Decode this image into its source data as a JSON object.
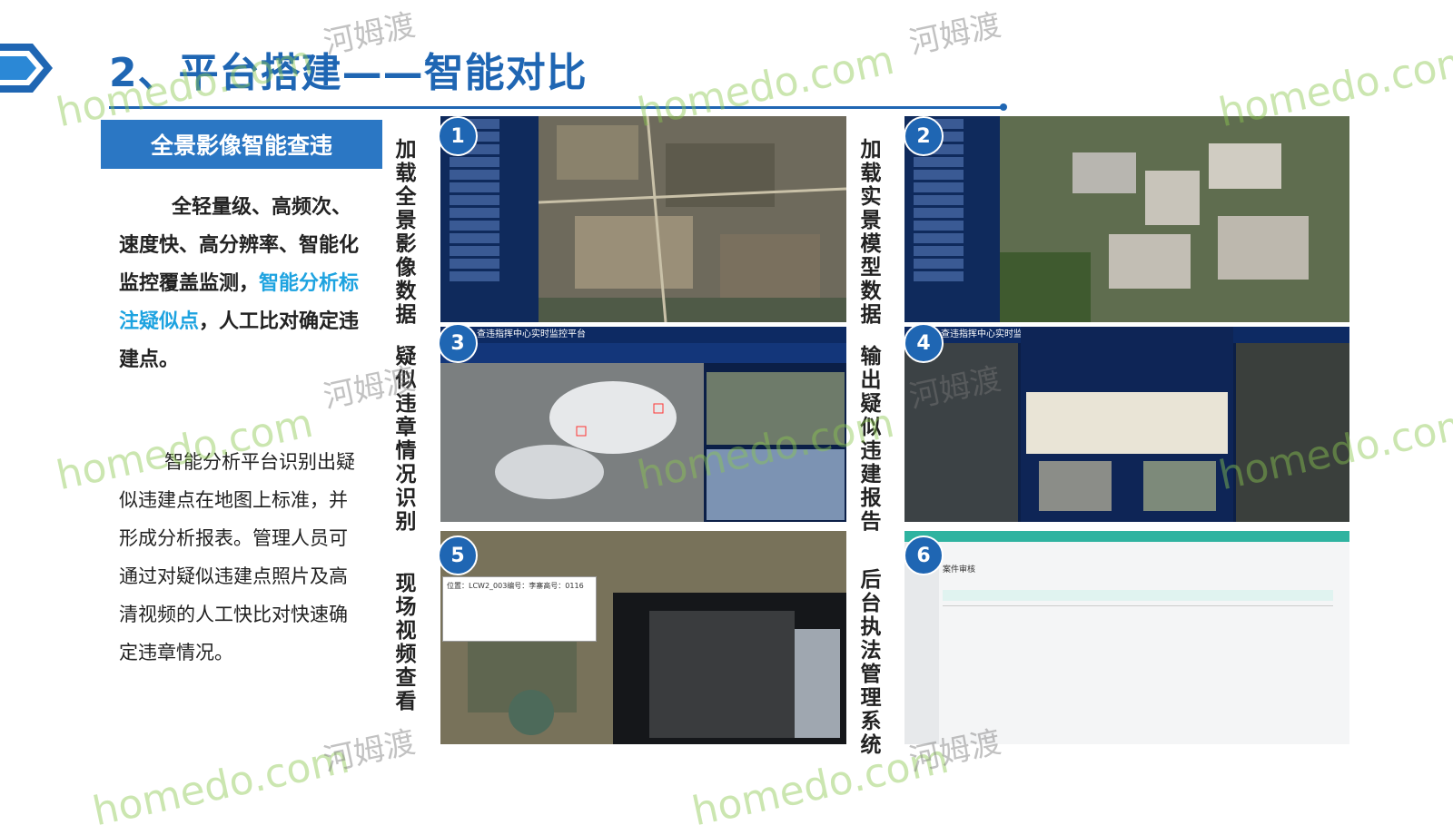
{
  "title": "2、平台搭建——智能对比",
  "section_heading": "全景影像智能查违",
  "para1": {
    "part1": "全轻量级、高频次、速度快、高分辨率、智能化监控覆盖监测，",
    "highlight": "智能分析标注疑似点",
    "part2": "，人工比对确定违建点。"
  },
  "para2": "智能分析平台识别出疑似违建点在地图上标准，并形成分析报表。管理人员可通过对疑似违建点照片及高清视频的人工快比对快速确定违章情况。",
  "labels": {
    "l1": "加载全景影像数据",
    "l2": "加载实景模型数据",
    "l3": "疑似违章情况识别",
    "l4": "输出疑似违建报告",
    "l5": "现场视频查看",
    "l6": "后台执法管理系统"
  },
  "badges": [
    "1",
    "2",
    "3",
    "4",
    "5",
    "6"
  ],
  "screens": {
    "s3_title": "查违指挥中心实时监控平台",
    "s4_title": "查违指挥中心实时监",
    "s5_popup": "位置：LCW2_003编号：李寨高号：0116",
    "s6_title": "案件审核"
  },
  "watermarks": {
    "latin": "homedo.com",
    "cn": "河姆渡"
  },
  "colors": {
    "title_blue": "#1f66b3",
    "section_blue": "#2b77c4",
    "highlight": "#1ea3e0"
  }
}
